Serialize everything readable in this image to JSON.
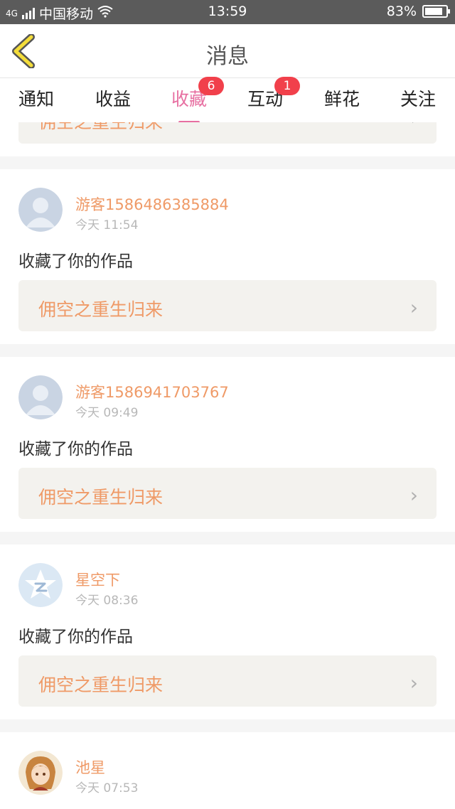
{
  "status_bar": {
    "network": "4G",
    "carrier": "中国移动",
    "time": "13:59",
    "battery": "83%"
  },
  "header": {
    "title": "消息"
  },
  "tabs": [
    {
      "label": "通知",
      "badge": null,
      "active": false
    },
    {
      "label": "收益",
      "badge": null,
      "active": false
    },
    {
      "label": "收藏",
      "badge": "6",
      "active": true
    },
    {
      "label": "互动",
      "badge": "1",
      "active": false
    },
    {
      "label": "鲜花",
      "badge": null,
      "active": false
    },
    {
      "label": "关注",
      "badge": null,
      "active": false
    }
  ],
  "partial_item": {
    "work_title": "佣空之重生归来"
  },
  "messages": [
    {
      "user": "游客1586486385884",
      "time": "今天 11:54",
      "action": "收藏了你的作品",
      "work_title": "佣空之重生归来",
      "avatar": "default-person-icon"
    },
    {
      "user": "游客1586941703767",
      "time": "今天 09:49",
      "action": "收藏了你的作品",
      "work_title": "佣空之重生归来",
      "avatar": "default-person-icon"
    },
    {
      "user": "星空下",
      "time": "今天 08:36",
      "action": "收藏了你的作品",
      "work_title": "佣空之重生归来",
      "avatar": "star-icon"
    },
    {
      "user": "池星",
      "time": "今天 07:53",
      "action": "",
      "work_title": "",
      "avatar": "anime-avatar"
    }
  ],
  "colors": {
    "accent": "#e76fa1",
    "username": "#ef9a67",
    "badge": "#f1404b",
    "statusbar": "#5b5b5b"
  }
}
